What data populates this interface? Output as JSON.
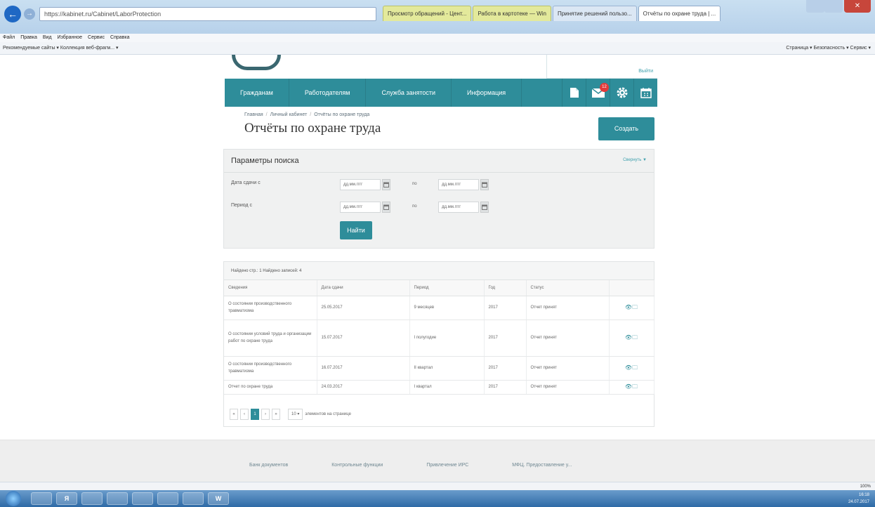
{
  "browser": {
    "address": "https://kabinet.ru/Cabinet/LaborProtection",
    "tabs": [
      {
        "label": "Просмотр обращений - Цент...",
        "style": "yellow"
      },
      {
        "label": "Работа в картотеке — Win",
        "style": "yellow"
      },
      {
        "label": "Принятие решений пользо...",
        "style": "plain"
      },
      {
        "label": "Отчёты по охране труда | ...",
        "style": "active"
      }
    ],
    "menu": [
      "Файл",
      "Правка",
      "Вид",
      "Избранное",
      "Сервис",
      "Справка"
    ],
    "favorites": "Рекомендуемые сайты ▾   Коллекция веб-фрагм... ▾",
    "commands": "Страница ▾   Безопасность ▾   Сервис ▾",
    "zoom": "100%"
  },
  "header": {
    "logout": "Выйти",
    "nav": [
      "Гражданам",
      "Работодателям",
      "Служба занятости",
      "Информация"
    ],
    "messages_badge": "12"
  },
  "breadcrumb": [
    "Главная",
    "Личный кабинет",
    "Отчёты по охране труда"
  ],
  "title": "Отчёты по охране труда",
  "create_label": "Создать",
  "search": {
    "title": "Параметры поиска",
    "collapse": "Свернуть ▼",
    "date_label": "Дата сдачи с",
    "period_label": "Период с",
    "placeholder": "дд.мм.гггг",
    "to": "по",
    "find_label": "Найти"
  },
  "results": {
    "summary": "Найдено стр.: 1 Найдено записей: 4",
    "columns": [
      "Сведения",
      "Дата сдачи",
      "Период",
      "Год",
      "Статус",
      ""
    ],
    "rows": [
      [
        "О состоянии производственного травматизма",
        "25.05.2017",
        "9 месяцев",
        "2017",
        "Отчет принят",
        "👁🗀"
      ],
      [
        "О состоянии условий труда и организации работ по охране труда",
        "15.07.2017",
        "I полугодие",
        "2017",
        "Отчет принят",
        "👁🗀"
      ],
      [
        "О состоянии производственного травматизма",
        "16.07.2017",
        "II квартал",
        "2017",
        "Отчет принят",
        "👁🗀"
      ],
      [
        "Отчет по охране труда",
        "24.03.2017",
        "I квартал",
        "2017",
        "Отчет принят",
        "👁🗀"
      ]
    ],
    "pager": {
      "first": "«",
      "prev": "‹",
      "current": "1",
      "next": "›",
      "last": "»",
      "per_page": "10",
      "per_page_text": "элементов на странице"
    }
  },
  "footer": {
    "links": [
      "Банк документов",
      "Контрольные функции",
      "Привлечение ИРС",
      "МФЦ. Предоставление у..."
    ]
  },
  "taskbar": {
    "items": [
      "",
      "Я",
      "",
      "",
      "",
      "",
      "",
      "W"
    ],
    "time": "16:18",
    "date": "24.07.2017"
  }
}
